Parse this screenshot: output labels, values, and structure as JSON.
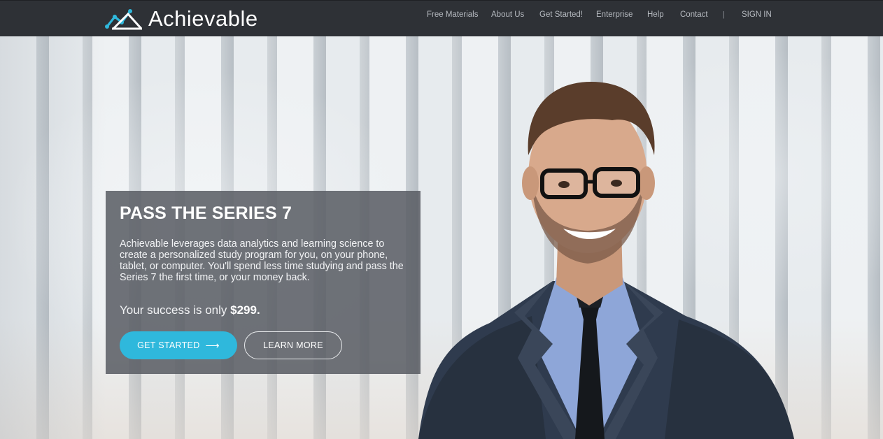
{
  "brand": {
    "name": "Achievable",
    "logo_icon": "chart-line-logo-icon"
  },
  "nav": {
    "items": [
      "Free Materials",
      "About Us",
      "Get Started!",
      "Enterprise",
      "Help",
      "Contact"
    ],
    "separator": "|",
    "sign_in": "SIGN IN"
  },
  "hero": {
    "title": "PASS THE SERIES 7",
    "description": "Achievable leverages data analytics and learning science to create a personalized study program for you, on your phone, tablet, or computer. You'll spend less time studying and pass the Series 7 the first time, or your money back.",
    "price_prefix": "Your success is only ",
    "price": "$299.",
    "primary_button": "GET STARTED",
    "primary_button_icon": "arrow-right-icon",
    "secondary_button": "LEARN MORE"
  },
  "colors": {
    "topbar": "#2e3136",
    "accent": "#2fb8dc",
    "card": "#585c63"
  }
}
